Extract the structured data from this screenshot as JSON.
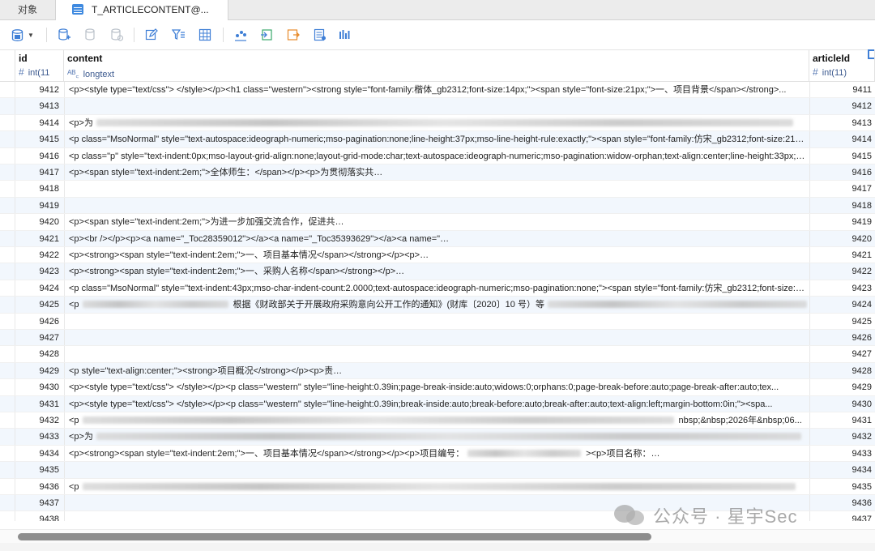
{
  "tabs": {
    "objects_label": "对象",
    "table_label": "T_ARTICLECONTENT@..."
  },
  "toolbar": {
    "icons": [
      "db-menu-icon",
      "add-record-icon",
      "delete-record-icon",
      "discard-icon",
      "edit-icon",
      "filter-icon",
      "grid-view-icon",
      "chart-icon",
      "import-icon",
      "export-icon",
      "form-view-icon",
      "bar-chart-icon"
    ]
  },
  "columns": {
    "id": {
      "name": "id",
      "type": "int(11",
      "type_symbol": "#"
    },
    "content": {
      "name": "content",
      "type": "longtext",
      "type_symbol": "ᴬᴮ꜀"
    },
    "articleId": {
      "name": "articleId",
      "type": "int(11)",
      "type_symbol": "#"
    }
  },
  "rows": [
    {
      "id": "9412",
      "content": "<p><style type=\"text/css\">          </style></p><h1 class=\"western\"><strong style=\"font-family:楷体_gb2312;font-size:14px;\"><span style=\"font-size:21px;\">一、项目背景</span></strong>...",
      "articleId": "9411"
    },
    {
      "id": "9413",
      "content": "",
      "articleId": "9412"
    },
    {
      "id": "9414",
      "content": "<p>为",
      "articleId": "9413",
      "blur": 860
    },
    {
      "id": "9415",
      "content": "<p class=\"MsoNormal\" style=\"text-autospace:ideograph-numeric;mso-pagination:none;line-height:37px;mso-line-height-rule:exactly;\"><span style=\"font-family:仿宋_gb2312;font-size:21px;\"...",
      "articleId": "9414"
    },
    {
      "id": "9416",
      "content": "<p class=\"p\" style=\"text-indent:0px;mso-layout-grid-align:none;layout-grid-mode:char;text-autospace:ideograph-numeric;mso-pagination:widow-orphan;text-align:center;line-height:33px;ms...",
      "articleId": "9415"
    },
    {
      "id": "9417",
      "content": "<p><span style=\"text-indent:2em;\">全体师生：</span></p><p>为贯彻落实共",
      "articleId": "9416",
      "blur": 570
    },
    {
      "id": "9418",
      "content": "",
      "articleId": "9417"
    },
    {
      "id": "9419",
      "content": "",
      "articleId": "9418"
    },
    {
      "id": "9420",
      "content": "<p><span style=\"text-indent:2em;\">为进一步加强交流合作，促进共",
      "articleId": "9419",
      "blur": 600
    },
    {
      "id": "9421",
      "content": "<p><br /></p><p><a name=\"_Toc28359012\"></a><a name=\"_Toc35393629\"></a><a name=\"",
      "articleId": "9420",
      "blur": 480
    },
    {
      "id": "9422",
      "content": "<p><strong><span style=\"text-indent:2em;\">一、项目基本情况</span></strong></p><p>",
      "articleId": "9421",
      "blur": 500
    },
    {
      "id": "9423",
      "content": "<p><strong><span style=\"text-indent:2em;\">一、采购人名称</span></strong></p>",
      "articleId": "9422",
      "blur": 520
    },
    {
      "id": "9424",
      "content": "<p class=\"MsoNormal\" style=\"text-indent:43px;mso-char-indent-count:2.0000;text-autospace:ideograph-numeric;mso-pagination:none;\"><span style=\"font-family:仿宋_gb2312;font-size:21p...",
      "articleId": "9423"
    },
    {
      "id": "9425",
      "content": "<p",
      "articleId": "9424",
      "blur": 180,
      "tail": "根据《财政部关于开展政府采购意向公开工作的通知》(财库〔2020〕10 号）等",
      "tail_blur": 320
    },
    {
      "id": "9426",
      "content": "",
      "articleId": "9425"
    },
    {
      "id": "9427",
      "content": "",
      "articleId": "9426"
    },
    {
      "id": "9428",
      "content": "",
      "articleId": "9427"
    },
    {
      "id": "9429",
      "content": "<p style=\"text-align:center;\"><strong>项目概况</strong></p><p>责",
      "articleId": "9428",
      "blur": 600
    },
    {
      "id": "9430",
      "content": "<p><style type=\"text/css\">          </style></p><p class=\"western\" style=\"line-height:0.39in;page-break-inside:auto;widows:0;orphans:0;page-break-before:auto;page-break-after:auto;tex...",
      "articleId": "9429"
    },
    {
      "id": "9431",
      "content": "<p><style type=\"text/css\">          </style></p><p class=\"western\" style=\"line-height:0.39in;break-inside:auto;break-before:auto;break-after:auto;text-align:left;margin-bottom:0in;\"><spa...",
      "articleId": "9430"
    },
    {
      "id": "9432",
      "content": "<p",
      "articleId": "9431",
      "blur": 730,
      "tail": "nbsp;&nbsp;2026年&nbsp;06..."
    },
    {
      "id": "9433",
      "content": "<p>为",
      "articleId": "9432",
      "blur": 870
    },
    {
      "id": "9434",
      "content": "<p><strong><span style=\"text-indent:2em;\">一、项目基本情况</span></strong></p><p>项目编号：",
      "articleId": "9433",
      "blur": 140,
      "tail": "><p>项目名称：",
      "tail_blur": 260,
      "tail2": "<p>采..."
    },
    {
      "id": "9435",
      "content": "",
      "articleId": "9434"
    },
    {
      "id": "9436",
      "content": "<p",
      "articleId": "9435",
      "blur": 880
    },
    {
      "id": "9437",
      "content": "",
      "articleId": "9436"
    },
    {
      "id": "9438",
      "content": "",
      "articleId": "9437"
    }
  ],
  "watermark": {
    "text": "公众号 · 星宇Sec"
  },
  "colors": {
    "accent": "#3f7fd6",
    "row_alt": "#f2f7fd"
  }
}
